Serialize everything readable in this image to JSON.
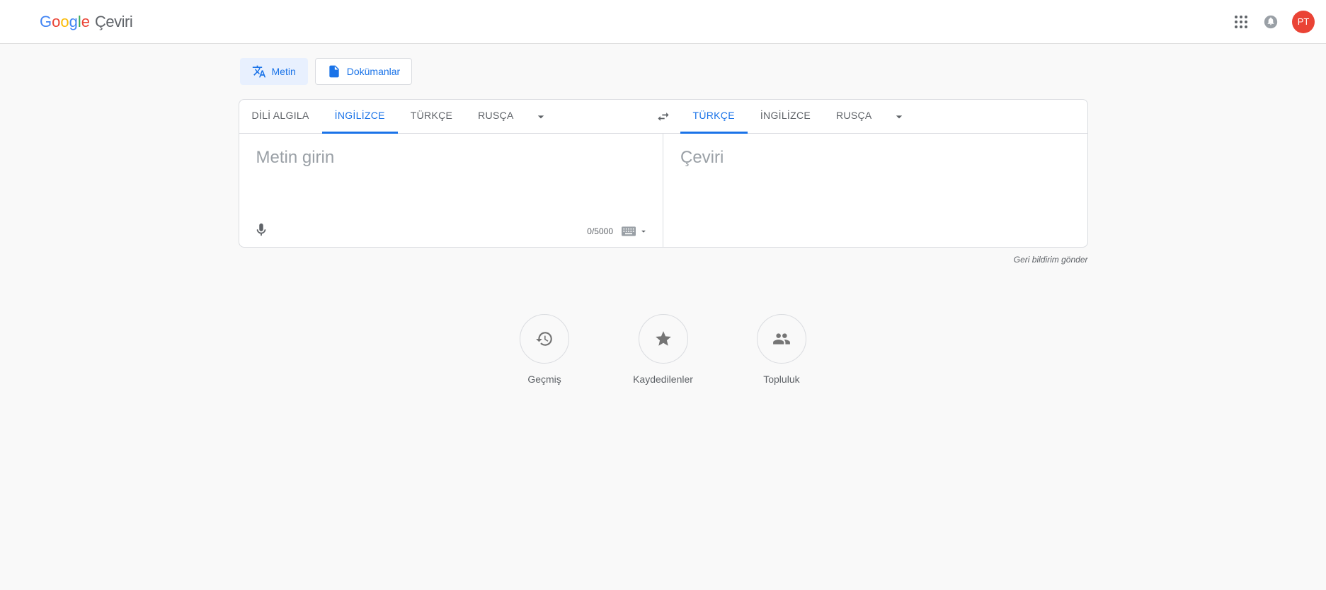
{
  "header": {
    "app_name": "Çeviri",
    "avatar_initials": "PT"
  },
  "mode_tabs": {
    "text": "Metin",
    "documents": "Dokümanlar"
  },
  "languages": {
    "source": {
      "detect": "DİLİ ALGILA",
      "english": "İNGİLİZCE",
      "turkish": "TÜRKÇE",
      "russian": "RUSÇA",
      "active": "english"
    },
    "target": {
      "turkish": "TÜRKÇE",
      "english": "İNGİLİZCE",
      "russian": "RUSÇA",
      "active": "turkish"
    }
  },
  "input": {
    "placeholder": "Metin girin",
    "char_count": "0/5000"
  },
  "output": {
    "placeholder": "Çeviri"
  },
  "feedback": "Geri bildirim gönder",
  "bottom_actions": {
    "history": "Geçmiş",
    "saved": "Kaydedilenler",
    "community": "Topluluk"
  }
}
